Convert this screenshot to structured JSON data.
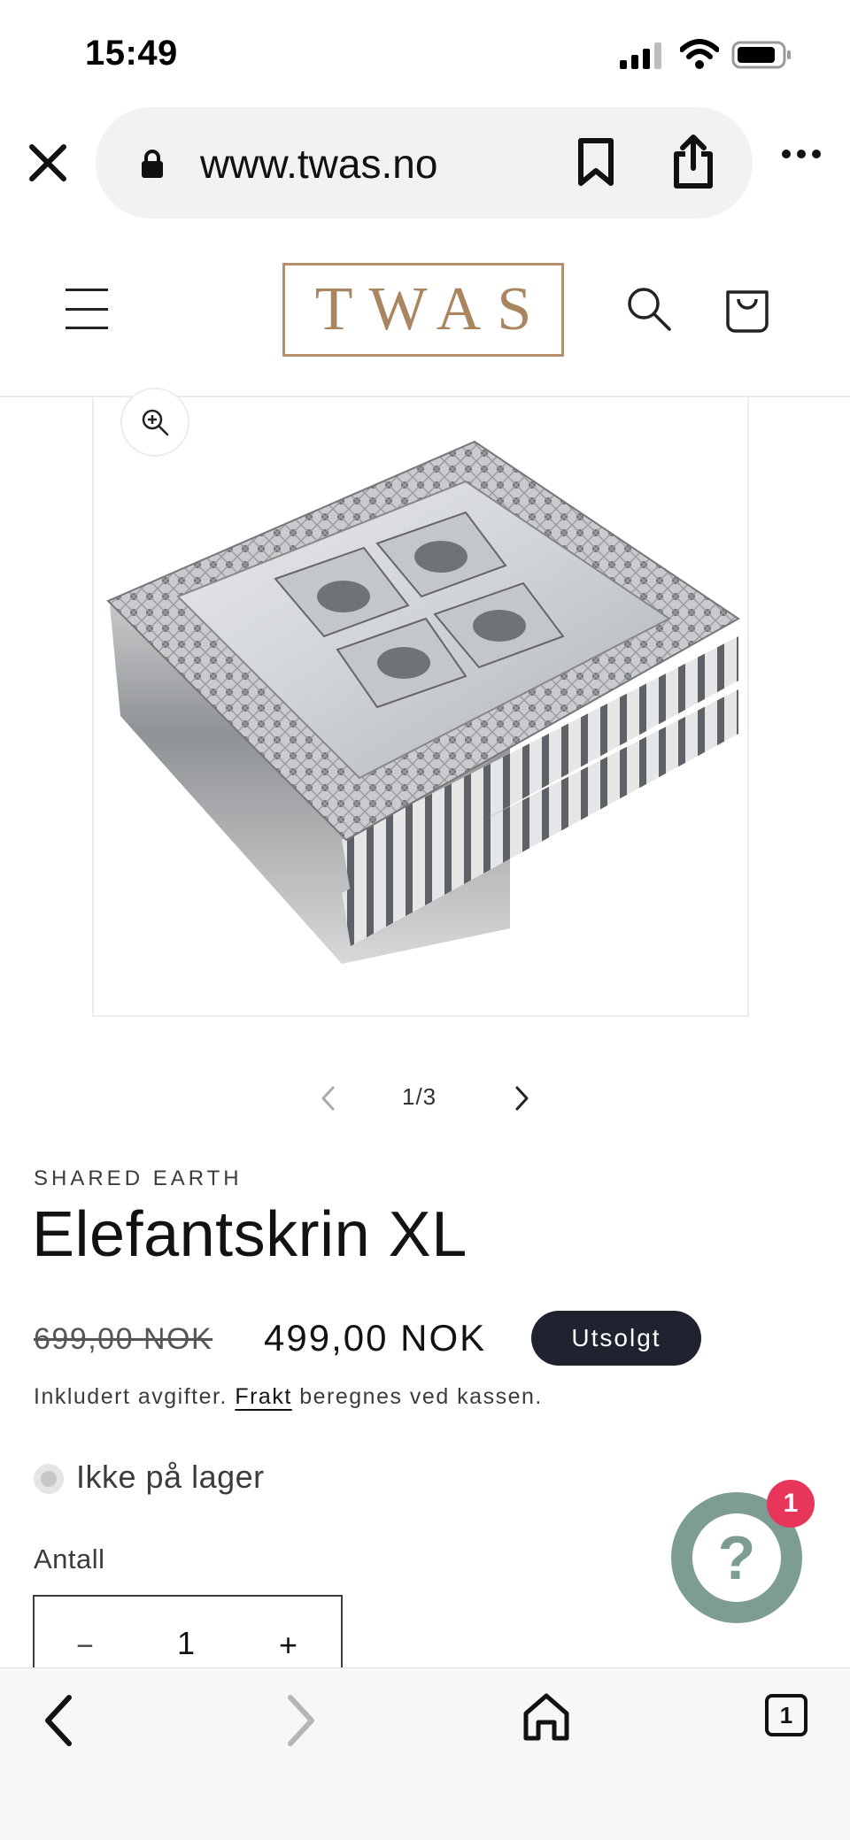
{
  "status_bar": {
    "time": "15:49"
  },
  "browser": {
    "url": "www.twas.no",
    "tab_count": "1"
  },
  "site": {
    "logo": "TWAS"
  },
  "gallery": {
    "counter": "1/3"
  },
  "product": {
    "vendor": "SHARED EARTH",
    "title": "Elefantskrin XL",
    "price_regular": "699,00 NOK",
    "price_sale": "499,00 NOK",
    "badge": "Utsolgt",
    "tax_note_prefix": "Inkludert avgifter. ",
    "shipping_link": "Frakt",
    "tax_note_suffix": " beregnes ved kassen.",
    "stock_status": "Ikke på lager",
    "quantity_label": "Antall",
    "quantity_value": "1",
    "quantity_minus": "−",
    "quantity_plus": "+"
  },
  "chat": {
    "icon_glyph": "?",
    "badge_count": "1"
  },
  "colors": {
    "logo_gold": "#b48f6a",
    "badge_dark": "#1f2330",
    "chat_green": "#7c9c94",
    "notification_red": "#e8355a"
  }
}
